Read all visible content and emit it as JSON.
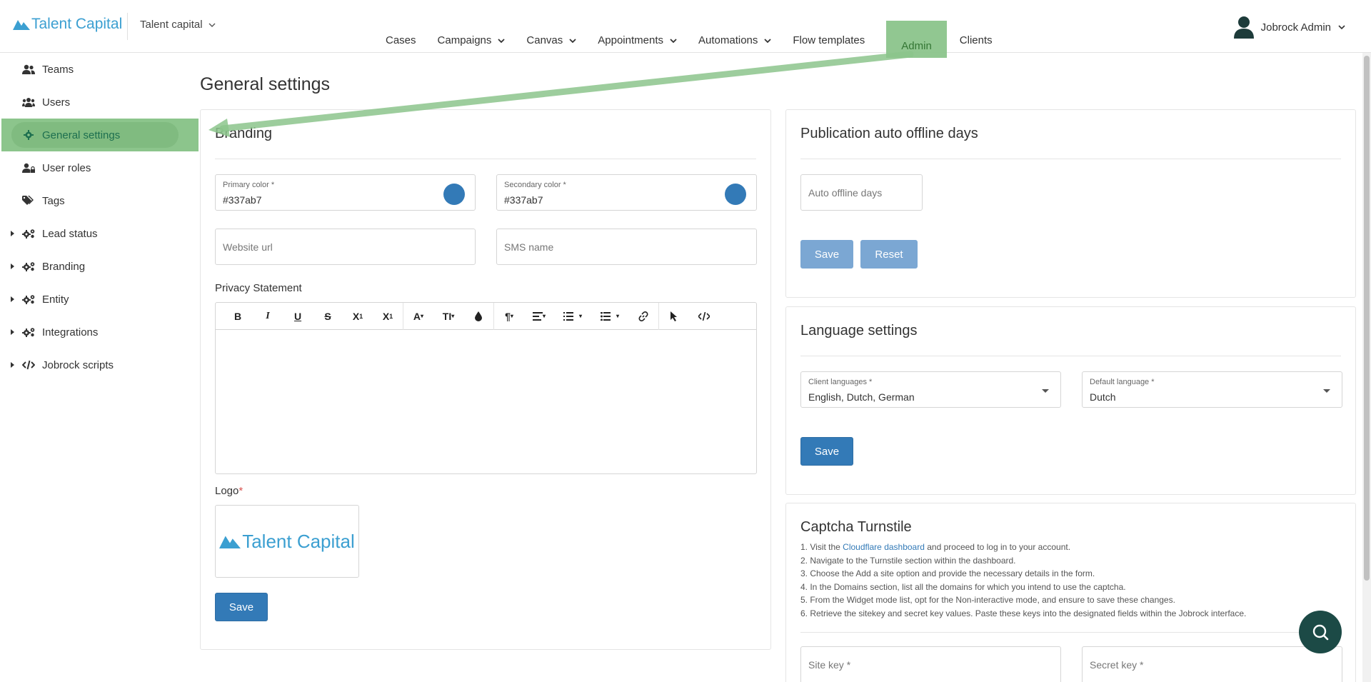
{
  "header": {
    "brand": "Talent Capital",
    "client": "Talent capital",
    "nav": [
      {
        "label": "Cases",
        "dropdown": false
      },
      {
        "label": "Campaigns",
        "dropdown": true
      },
      {
        "label": "Canvas",
        "dropdown": true
      },
      {
        "label": "Appointments",
        "dropdown": true
      },
      {
        "label": "Automations",
        "dropdown": true
      },
      {
        "label": "Flow templates",
        "dropdown": false
      },
      {
        "label": "Admin",
        "dropdown": false,
        "active": true
      },
      {
        "label": "Clients",
        "dropdown": false
      }
    ],
    "user": "Jobrock Admin"
  },
  "sidebar": {
    "items": [
      {
        "label": "Teams",
        "icon": "users-icon"
      },
      {
        "label": "Users",
        "icon": "users-group-icon"
      },
      {
        "label": "General settings",
        "icon": "gear-icon",
        "active": true
      },
      {
        "label": "User roles",
        "icon": "user-lock-icon"
      },
      {
        "label": "Tags",
        "icon": "tags-icon"
      },
      {
        "label": "Lead status",
        "icon": "cogs-icon",
        "expandable": true
      },
      {
        "label": "Branding",
        "icon": "cogs-icon",
        "expandable": true
      },
      {
        "label": "Entity",
        "icon": "cogs-icon",
        "expandable": true
      },
      {
        "label": "Integrations",
        "icon": "cogs-icon",
        "expandable": true
      },
      {
        "label": "Jobrock scripts",
        "icon": "code-icon",
        "expandable": true
      }
    ]
  },
  "main": {
    "page_title": "General settings",
    "branding": {
      "title": "Branding",
      "primary_label": "Primary color *",
      "primary_value": "#337ab7",
      "secondary_label": "Secondary color *",
      "secondary_value": "#337ab7",
      "website_placeholder": "Website url",
      "sms_placeholder": "SMS name",
      "privacy_label": "Privacy Statement",
      "logo_label": "Logo",
      "logo_required": "*",
      "logo_text": "Talent Capital",
      "save": "Save"
    },
    "publication": {
      "title": "Publication auto offline days",
      "placeholder": "Auto offline days",
      "save": "Save",
      "reset": "Reset"
    },
    "language": {
      "title": "Language settings",
      "client_label": "Client languages *",
      "client_value": "English, Dutch, German",
      "default_label": "Default language *",
      "default_value": "Dutch",
      "save": "Save"
    },
    "captcha": {
      "title": "Captcha Turnstile",
      "step1_pre": "1. Visit the ",
      "step1_link": "Cloudflare dashboard",
      "step1_post": " and proceed to log in to your account.",
      "step2": "2. Navigate to the Turnstile section within the dashboard.",
      "step3": "3. Choose the Add a site option and provide the necessary details in the form.",
      "step4": "4. In the Domains section, list all the domains for which you intend to use the captcha.",
      "step5": "5. From the Widget mode list, opt for the Non-interactive mode, and ensure to save these changes.",
      "step6": "6. Retrieve the sitekey and secret key values. Paste these keys into the designated fields within the Jobrock interface.",
      "site_key": "Site key *",
      "secret_key": "Secret key *"
    }
  },
  "colors": {
    "primary": "#337ab7",
    "highlight": "#8cc58c",
    "fab": "#1c4a46"
  }
}
